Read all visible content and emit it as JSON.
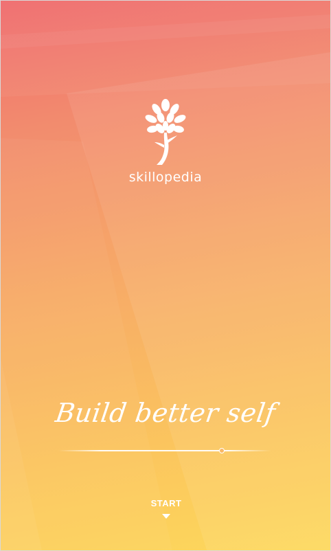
{
  "brand": {
    "name": "skillopedia",
    "logo_icon": "tree-icon"
  },
  "tagline": "Build better self",
  "start_button": {
    "label": "START",
    "icon": "chevron-down-icon"
  },
  "colors": {
    "gradient_top": "#f06a6c",
    "gradient_bottom": "#fdd85b",
    "text": "#ffffff"
  }
}
